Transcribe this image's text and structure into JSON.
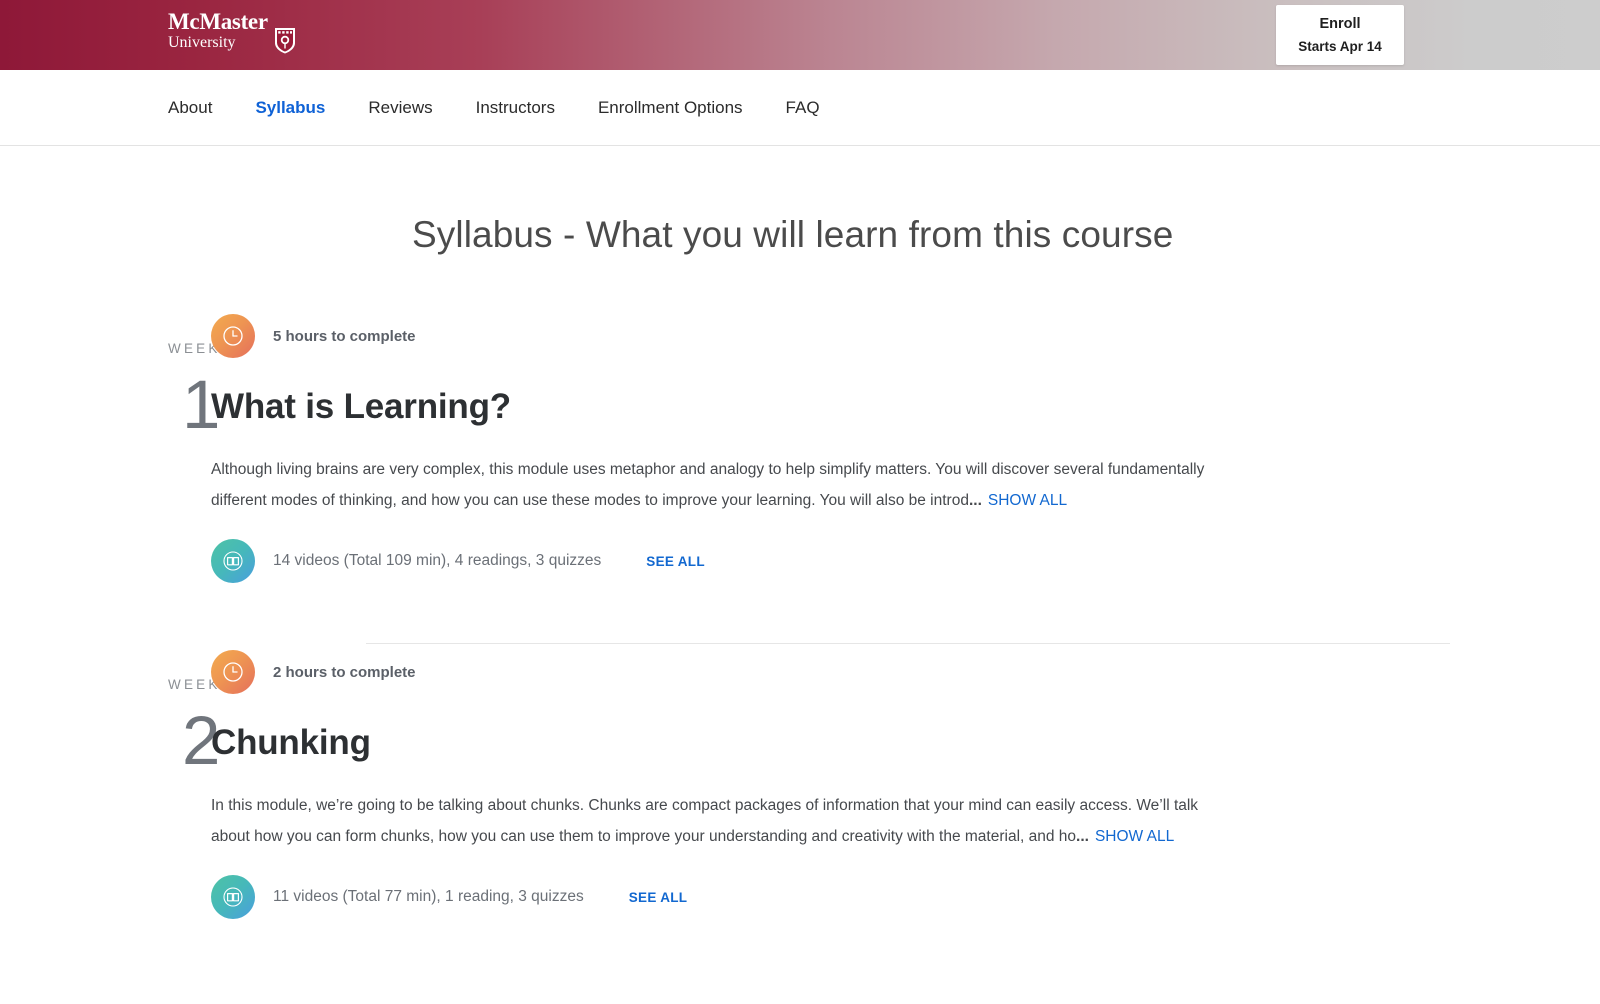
{
  "brand": {
    "logo_primary": "McMaster",
    "logo_secondary": "University",
    "crest_icon": "shield-crest-icon",
    "gradient_start": "#8e1838",
    "gradient_end": "#cccccc"
  },
  "enroll": {
    "label": "Enroll",
    "sub_label": "Starts Apr 14"
  },
  "nav": {
    "items": [
      {
        "label": "About",
        "active": false
      },
      {
        "label": "Syllabus",
        "active": true
      },
      {
        "label": "Reviews",
        "active": false
      },
      {
        "label": "Instructors",
        "active": false
      },
      {
        "label": "Enrollment Options",
        "active": false
      },
      {
        "label": "FAQ",
        "active": false
      }
    ],
    "active_color": "#0f62d6"
  },
  "page": {
    "title": "Syllabus - What you will learn from this course"
  },
  "weeks": [
    {
      "week_label": "WEEK",
      "week_number": "1",
      "clock_icon": "clock-icon",
      "hours": "5 hours to complete",
      "title": "What is Learning?",
      "description": "Although living brains are very complex, this module uses metaphor and analogy to help simplify matters. You will discover several fundamentally different modes of thinking, and how you can use these modes to improve your learning. You will also be introd",
      "description_ellipsis": "...",
      "show_all_label": "SHOW ALL",
      "book_icon": "book-icon",
      "content_summary": "14 videos (Total 109 min), 4 readings, 3 quizzes",
      "see_all_label": "SEE ALL"
    },
    {
      "week_label": "WEEK",
      "week_number": "2",
      "clock_icon": "clock-icon",
      "hours": "2 hours to complete",
      "title": "Chunking",
      "description": "In this module, we’re going to be talking about chunks. Chunks are compact packages of information that your mind can easily access. We’ll talk about how you can form chunks, how you can use them to improve your understanding and creativity with the material, and ho",
      "description_ellipsis": "...",
      "show_all_label": "SHOW ALL",
      "book_icon": "book-icon",
      "content_summary": "11 videos (Total 77 min), 1 reading, 3 quizzes",
      "see_all_label": "SEE ALL"
    }
  ]
}
